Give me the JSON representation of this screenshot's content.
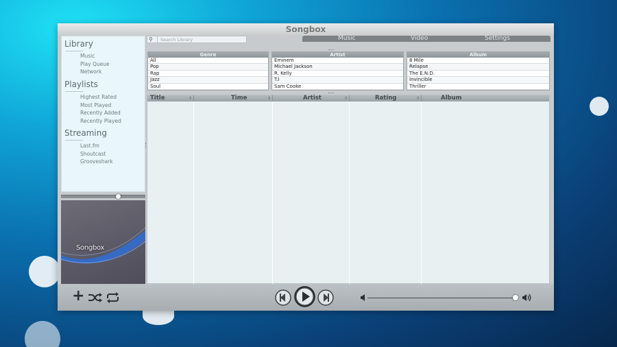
{
  "window": {
    "title": "Songbox"
  },
  "search": {
    "placeholder": "Search Library"
  },
  "tabs": [
    {
      "label": "Music",
      "active": true
    },
    {
      "label": "Video",
      "active": false
    },
    {
      "label": "Settings",
      "active": false
    }
  ],
  "sidebar": {
    "library": {
      "title": "Library",
      "items": [
        "Music",
        "Play Queue",
        "Network"
      ]
    },
    "playlists": {
      "title": "Playlists",
      "items": [
        "Highest Rated",
        "Most Played",
        "Recently Added",
        "Recently Played"
      ]
    },
    "streaming": {
      "title": "Streaming",
      "items": [
        "Last.fm",
        "Shoutcast",
        "Grooveshark"
      ]
    }
  },
  "album_art": {
    "logo_text": "Songbox"
  },
  "filters": {
    "genre": {
      "header": "Genre",
      "items": [
        "All",
        "Pop",
        "Rap",
        "Jazz",
        "Soul"
      ]
    },
    "artist": {
      "header": "Artist",
      "items": [
        "Eminem",
        "Michael Jackson",
        "R. Kelly",
        "T.I",
        "Sam Cooke"
      ]
    },
    "album": {
      "header": "Album",
      "items": [
        "8 Mile",
        "Relapse",
        "The E.N.D.",
        "Invincible",
        "Thriller"
      ]
    }
  },
  "tracklist": {
    "columns": [
      "Title",
      "Time",
      "Artist",
      "Rating",
      "Album"
    ]
  },
  "controls": {
    "icons": [
      "add-icon",
      "shuffle-icon",
      "repeat-icon",
      "previous-icon",
      "play-icon",
      "next-icon",
      "volume-low-icon",
      "volume-high-icon"
    ],
    "volume_level": 0.99,
    "seek_position": 0.68
  },
  "colors": {
    "accent_blue": "#2f6fd6",
    "window_bg": "#c7cbcd",
    "sidebar_bg": "#e9f6fb"
  }
}
